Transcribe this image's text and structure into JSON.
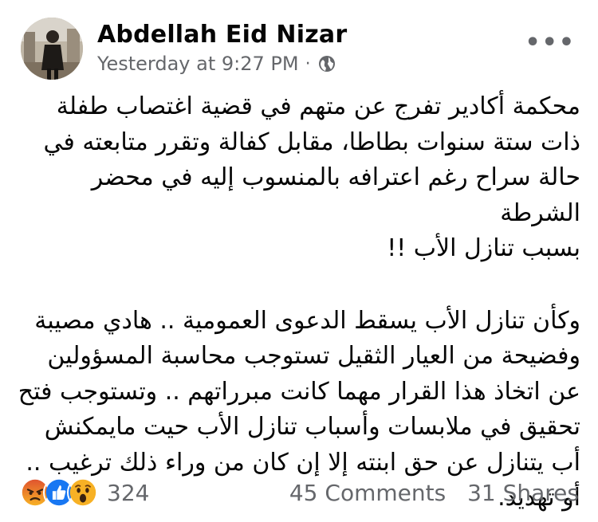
{
  "post": {
    "author": "Abdellah Eid Nizar",
    "timestamp": "Yesterday at 9:27 PM",
    "separator": "·",
    "privacy_icon": "globe-icon",
    "more_icon": "more-options-icon",
    "more_text": "•••",
    "body": {
      "line1": "محكمة أكادير تفرج عن متهم في قضية اغتصاب طفلة",
      "line2": "ذات ستة سنوات بطاطا، مقابل كفالة وتقرر متابعته في",
      "line3": "حالة سراح رغم اعترافه بالمنسوب إليه في محضر الشرطة",
      "line4": "بسبب تنازل الأب !!",
      "line5": "وكأن تنازل الأب يسقط الدعوى العمومية .. هادي مصيبة",
      "line6": "وفضيحة من العيار الثقيل تستوجب محاسبة المسؤولين",
      "line7": "عن اتخاذ هذا القرار مهما كانت مبرراتهم .. وتستوجب فتح",
      "line8": "تحقيق في ملابسات وأسباب تنازل الأب حيت مايمكنش",
      "line9": "أب يتنازل عن حق ابنته إلا إن كان من وراء ذلك ترغيب ..",
      "line10": "أو تهديد."
    }
  },
  "footer": {
    "reactions": [
      "angry-reaction-icon",
      "like-reaction-icon",
      "wow-reaction-icon"
    ],
    "reaction_count": "324",
    "comments": "45 Comments",
    "shares": "31 Shares"
  },
  "colors": {
    "text": "#050505",
    "secondary": "#65676b",
    "like": "#1877f2",
    "angry": "#e9710f",
    "wow": "#f7b125"
  }
}
